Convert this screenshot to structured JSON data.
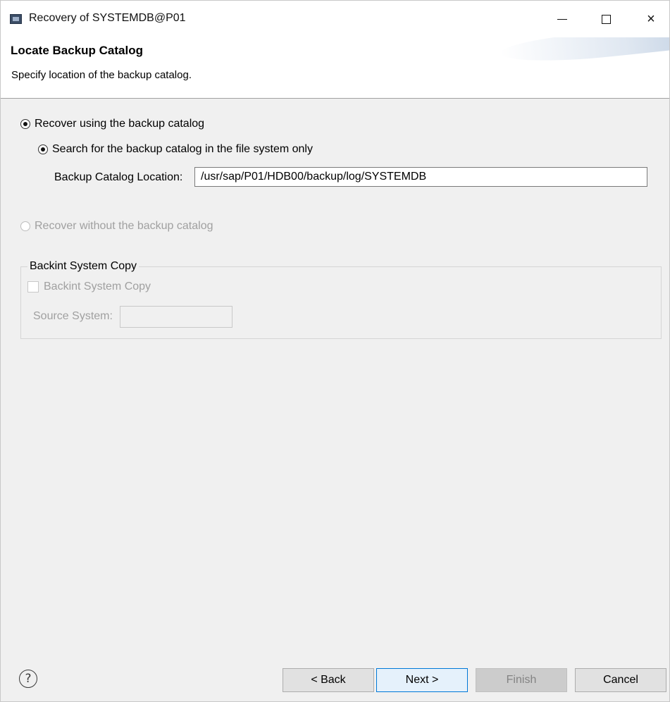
{
  "window": {
    "title": "Recovery of SYSTEMDB@P01",
    "app_icon": "window-app-icon",
    "controls": {
      "minimize": "minimize-icon",
      "maximize": "maximize-icon",
      "close": "×"
    }
  },
  "header": {
    "title": "Locate Backup Catalog",
    "description": "Specify location of the backup catalog."
  },
  "options": {
    "use_catalog": {
      "label": "Recover using the backup catalog",
      "selected": true
    },
    "search_fs": {
      "label": "Search for the backup catalog in the file system only",
      "selected": true
    },
    "catalog_location": {
      "label": "Backup Catalog Location:",
      "value": "/usr/sap/P01/HDB00/backup/log/SYSTEMDB"
    },
    "without_catalog": {
      "label": "Recover without the backup catalog",
      "selected": false,
      "enabled": false
    }
  },
  "backint_group": {
    "title": "Backint System Copy",
    "checkbox_label": "Backint System Copy",
    "source_label": "Source System:",
    "source_value": ""
  },
  "footer": {
    "help": "?",
    "back": "< Back",
    "next": "Next >",
    "finish": "Finish",
    "cancel": "Cancel"
  },
  "colors": {
    "window_bg": "#f0f0f0",
    "accent": "#0078d7",
    "disabled_text": "#a0a0a0"
  }
}
